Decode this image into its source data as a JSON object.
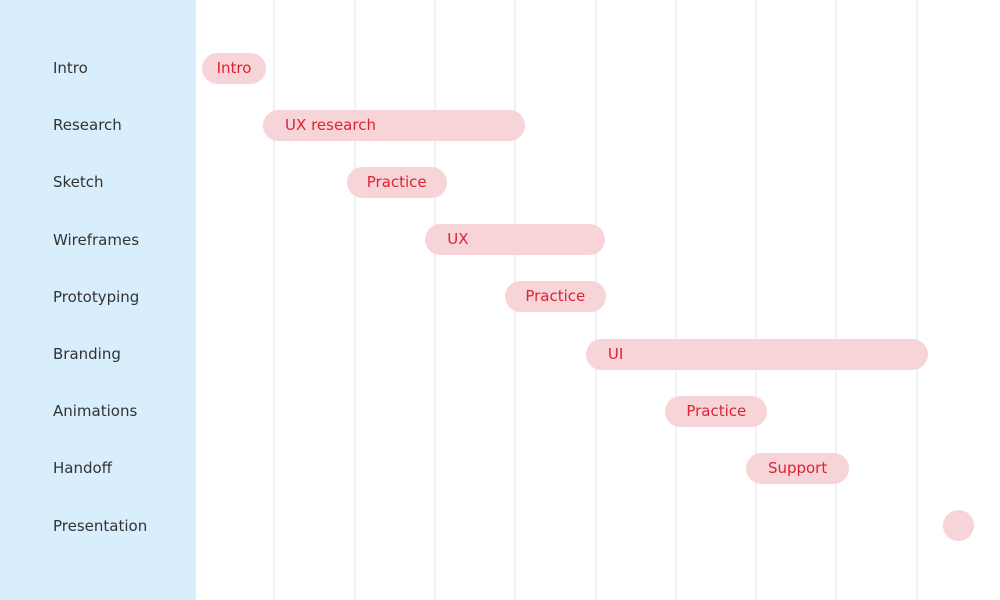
{
  "chart_data": {
    "type": "gantt",
    "title": "",
    "xlabel": "",
    "ylabel": "",
    "x_unit": "column",
    "xlim": [
      0,
      10
    ],
    "grid": true,
    "gridlines": [
      1,
      2,
      3,
      4,
      5,
      6,
      7,
      8,
      9
    ],
    "colors": {
      "bar_fill": "#f7d4d8",
      "bar_text": "#dd2233",
      "sidebar": "#d9eefd",
      "row_text": "#333333"
    },
    "rows": [
      {
        "label": "Intro",
        "task": "Intro",
        "start": 0.1,
        "end": 0.9
      },
      {
        "label": "Research",
        "task": "UX research",
        "start": 0.86,
        "end": 4.12
      },
      {
        "label": "Sketch",
        "task": "Practice",
        "start": 1.9,
        "end": 3.15
      },
      {
        "label": "Wireframes",
        "task": "UX",
        "start": 2.88,
        "end": 5.12
      },
      {
        "label": "Prototyping",
        "task": "Practice",
        "start": 3.87,
        "end": 5.13
      },
      {
        "label": "Branding",
        "task": "UI",
        "start": 4.88,
        "end": 9.14
      },
      {
        "label": "Animations",
        "task": "Practice",
        "start": 5.87,
        "end": 7.14
      },
      {
        "label": "Handoff",
        "task": "Support",
        "start": 6.87,
        "end": 8.16
      },
      {
        "label": "Presentation",
        "task": "",
        "start": 9.33,
        "end": 9.71
      }
    ]
  }
}
